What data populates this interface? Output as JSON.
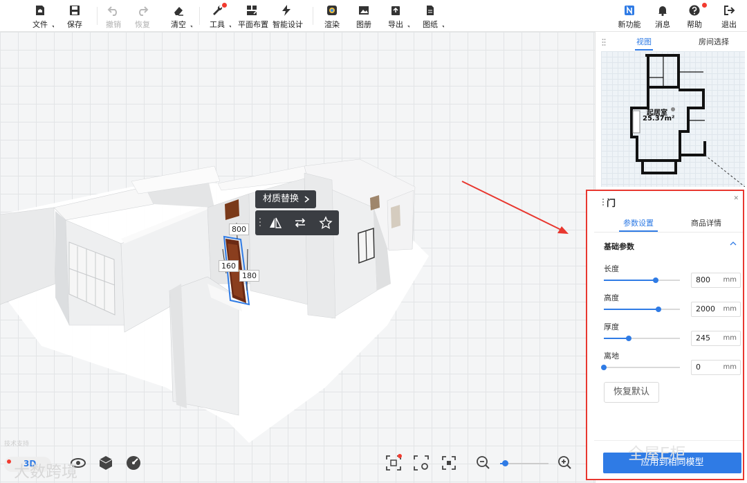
{
  "toolbar": {
    "left": [
      {
        "label": "文件",
        "icon": "house-file-icon",
        "disabled": false,
        "caret": true
      },
      {
        "label": "保存",
        "icon": "save-icon",
        "disabled": false,
        "caret": false
      },
      {
        "label": "撤销",
        "icon": "undo-icon",
        "disabled": true,
        "caret": false
      },
      {
        "label": "恢复",
        "icon": "redo-icon",
        "disabled": true,
        "caret": false
      },
      {
        "label": "清空",
        "icon": "eraser-icon",
        "disabled": false,
        "caret": true
      },
      {
        "label": "工具",
        "icon": "wrench-icon",
        "disabled": false,
        "caret": true
      },
      {
        "label": "平面布置",
        "icon": "floor-layout-icon",
        "disabled": false,
        "caret": false
      },
      {
        "label": "智能设计",
        "icon": "lightning-icon",
        "disabled": false,
        "caret": true
      },
      {
        "label": "渲染",
        "icon": "render-icon",
        "disabled": false,
        "caret": false
      },
      {
        "label": "图册",
        "icon": "album-icon",
        "disabled": false,
        "caret": false
      },
      {
        "label": "导出",
        "icon": "export-icon",
        "disabled": false,
        "caret": true
      },
      {
        "label": "图纸",
        "icon": "drawing-icon",
        "disabled": false,
        "caret": true
      }
    ],
    "right": [
      {
        "label": "新功能",
        "icon": "new-feature-icon"
      },
      {
        "label": "消息",
        "icon": "bell-icon"
      },
      {
        "label": "帮助",
        "icon": "help-icon"
      },
      {
        "label": "退出",
        "icon": "exit-icon"
      }
    ]
  },
  "viewport": {
    "material_tip": "材质替换",
    "dims": {
      "width": "800",
      "left": "160",
      "right": "180"
    },
    "view_mode": "3D",
    "watermark_left": "大数跨境",
    "watermark_right": "全屋E柜"
  },
  "minimap": {
    "tabs": [
      "视图",
      "房间选择"
    ],
    "active_tab": "视图",
    "room_name": "起居室",
    "room_area": "25.37m²"
  },
  "panel": {
    "title": "门",
    "tabs": [
      "参数设置",
      "商品详情"
    ],
    "active_tab": "参数设置",
    "section": "基础参数",
    "fields": [
      {
        "label": "长度",
        "value": "800",
        "unit": "mm",
        "level": 0.68
      },
      {
        "label": "高度",
        "value": "2000",
        "unit": "mm",
        "level": 0.72
      },
      {
        "label": "厚度",
        "value": "245",
        "unit": "mm",
        "level": 0.33
      },
      {
        "label": "离地",
        "value": "0",
        "unit": "mm",
        "level": 0.0
      }
    ],
    "reset_label": "恢复默认",
    "apply_label": "应用到相同模型"
  },
  "zoom": {
    "level": 0.1
  }
}
